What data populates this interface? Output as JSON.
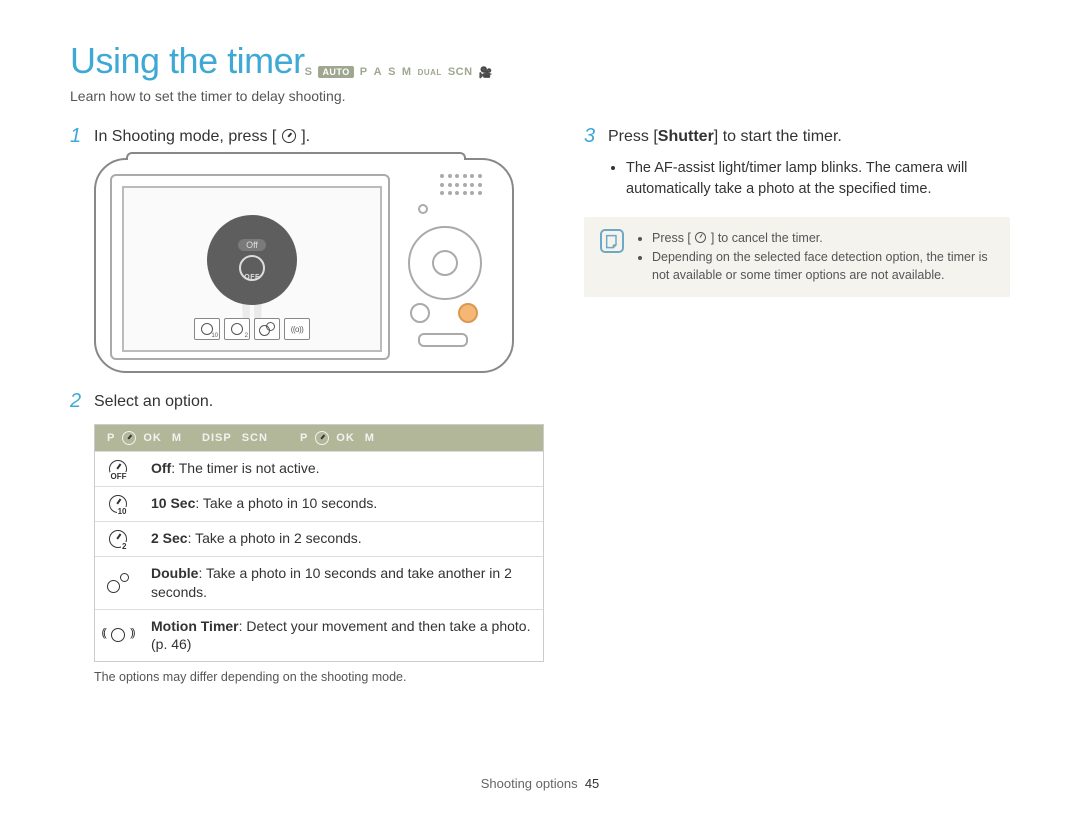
{
  "header": {
    "title": "Using the timer",
    "mode_icons": [
      "S",
      "AUTO",
      "P",
      "A",
      "S",
      "M",
      "DUAL",
      "SCN"
    ],
    "subtitle": "Learn how to set the timer to delay shooting."
  },
  "left": {
    "step1": {
      "num": "1",
      "text_a": "In Shooting mode, press [",
      "text_b": "]."
    },
    "camera_dial_off_label": "Off",
    "camera_dial_off_text": "OFF",
    "step2": {
      "num": "2",
      "text": "Select an option."
    },
    "options_header_labels": [
      "P",
      "OK",
      "M",
      "DISP",
      "SCN",
      "P",
      "OK",
      "M"
    ],
    "options": [
      {
        "icon_sub": "OFF",
        "bold": "Off",
        "rest": ": The timer is not active."
      },
      {
        "icon_sub": "10",
        "bold": "10 Sec",
        "rest": ": Take a photo in 10 seconds."
      },
      {
        "icon_sub": "2",
        "bold": "2 Sec",
        "rest": ": Take a photo in 2 seconds."
      },
      {
        "icon_sub": "",
        "bold": "Double",
        "rest": ": Take a photo in 10 seconds and take another in 2 seconds."
      },
      {
        "icon_sub": "",
        "bold": "Motion Timer",
        "rest": ": Detect your movement and then take a photo. (p. 46)"
      }
    ],
    "footnote": "The options may differ depending on the shooting mode."
  },
  "right": {
    "step3": {
      "num": "3",
      "text_a": "Press [",
      "text_bold": "Shutter",
      "text_b": "] to start the timer."
    },
    "bullets": [
      "The AF-assist light/timer lamp blinks. The camera will automatically take a photo at the specified time."
    ],
    "notes": {
      "n1_a": "Press [",
      "n1_b": "] to cancel the timer.",
      "n2": "Depending on the selected face detection option, the timer is not available or some timer options are not available."
    }
  },
  "footer": {
    "section": "Shooting options",
    "page": "45"
  }
}
